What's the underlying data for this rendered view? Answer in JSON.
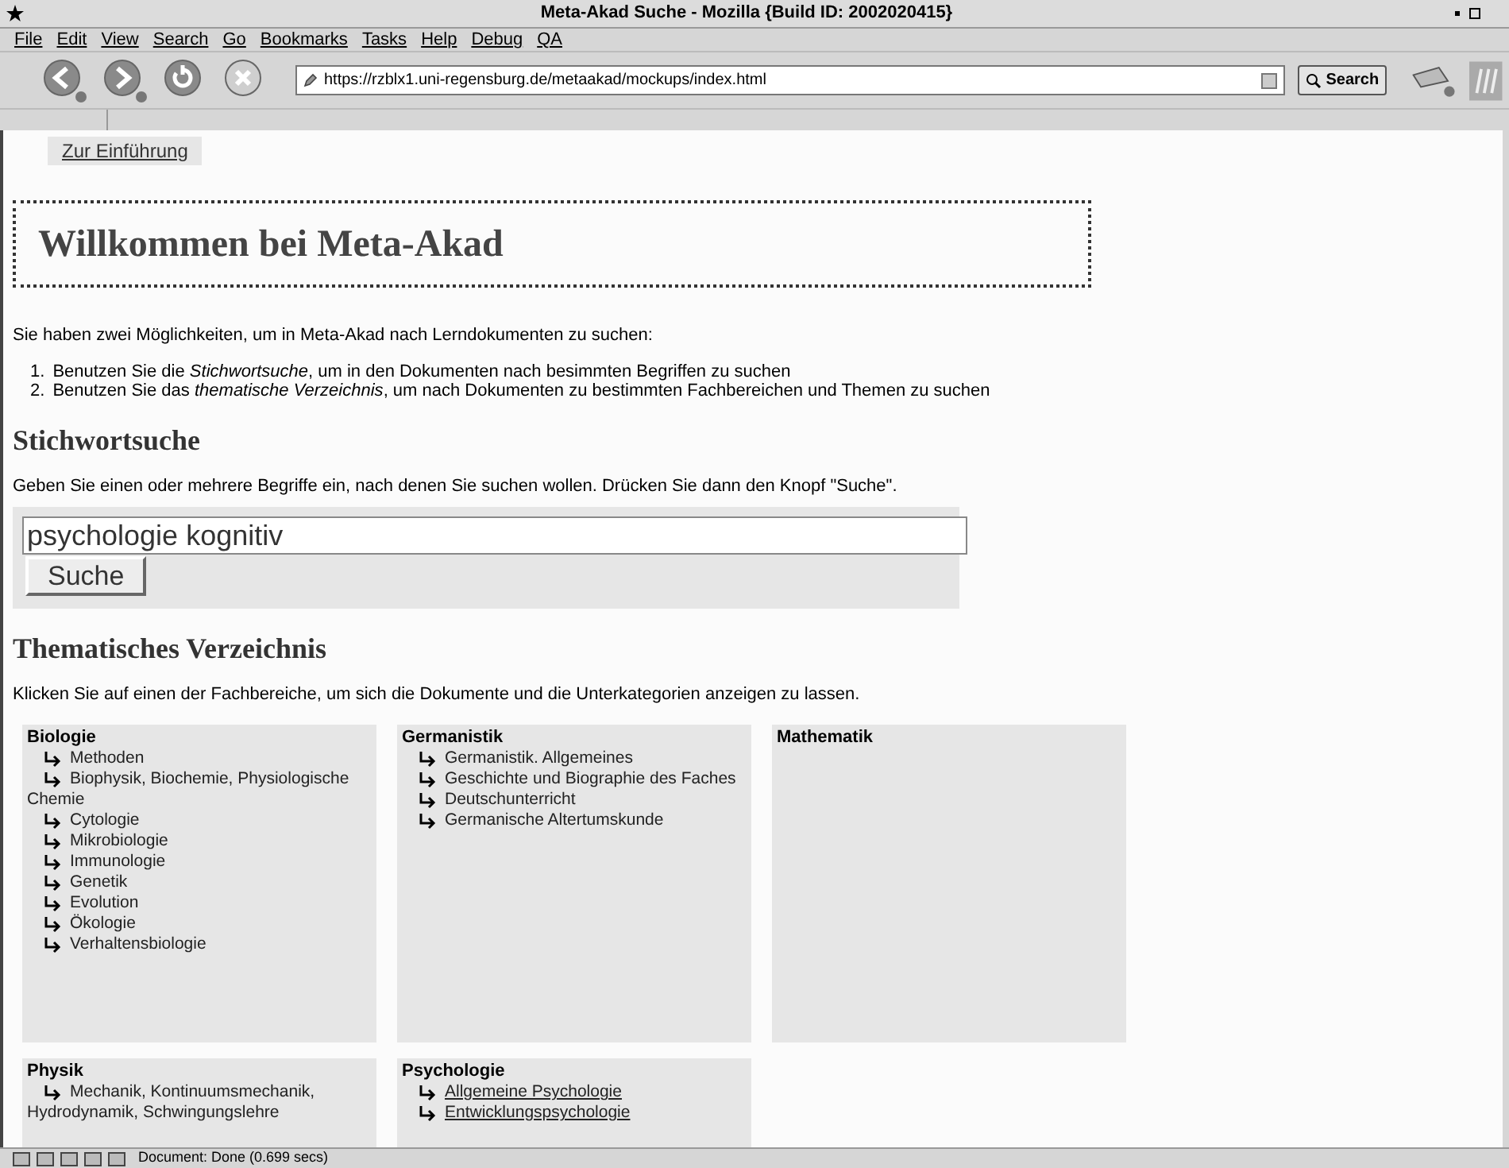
{
  "window": {
    "title": "Meta-Akad Suche - Mozilla {Build ID: 2002020415}"
  },
  "menu": [
    "File",
    "Edit",
    "View",
    "Search",
    "Go",
    "Bookmarks",
    "Tasks",
    "Help",
    "Debug",
    "QA"
  ],
  "toolbar": {
    "url": "https://rzblx1.uni-regensburg.de/metaakad/mockups/index.html",
    "search_button": "Search"
  },
  "nav_link": "Zur Einführung",
  "heading": "Willkommen bei Meta-Akad",
  "intro": "Sie haben zwei Möglichkeiten, um in Meta-Akad nach Lerndokumenten zu suchen:",
  "options": [
    {
      "number": "1.",
      "text": "Benutzen Sie die *Stichwortsuche*, um in den Dokumenten nach besimmten Begriffen zu suchen"
    },
    {
      "number": "2.",
      "text": "Benutzen Sie das *thematische  Verzeichnis*, um nach Dokumenten zu bestimmten Fachbereichen und Themen zu suchen"
    }
  ],
  "keyword_search": {
    "title": "Stichwortsuche",
    "hint": "Geben Sie einen oder mehrere Begriffe ein, nach denen Sie suchen wollen. Drücken Sie dann den Knopf \"Suche\".",
    "value": "psychologie kognitiv",
    "button": "Suche"
  },
  "directory": {
    "title": "Thematisches Verzeichnis",
    "hint": "Klicken Sie auf einen der Fachbereiche, um sich die Dokumente und die Unterkategorien anzeigen zu lassen.",
    "categories": [
      {
        "name": "Biologie",
        "children": [
          {
            "label": "Methoden",
            "underlined": false
          },
          {
            "label": "Biophysik, Biochemie, Physiologische Chemie",
            "underlined": false
          },
          {
            "label": "Cytologie",
            "underlined": false
          },
          {
            "label": "Mikrobiologie",
            "underlined": false
          },
          {
            "label": "Immunologie",
            "underlined": false
          },
          {
            "label": "Genetik",
            "underlined": false
          },
          {
            "label": "Evolution",
            "underlined": false
          },
          {
            "label": "Ökologie",
            "underlined": false
          },
          {
            "label": "Verhaltensbiologie",
            "underlined": false
          }
        ]
      },
      {
        "name": "Germanistik",
        "children": [
          {
            "label": "Germanistik. Allgemeines",
            "underlined": false
          },
          {
            "label": "Geschichte und Biographie des Faches",
            "underlined": false
          },
          {
            "label": "Deutschunterricht",
            "underlined": false
          },
          {
            "label": "Germanische Altertumskunde",
            "underlined": false
          }
        ]
      },
      {
        "name": "Mathematik"
      },
      {
        "name": "Physik",
        "children": [
          {
            "label": "Mechanik, Kontinuumsmechanik, Hydrodynamik, Schwingungslehre",
            "underlined": false
          }
        ]
      },
      {
        "name": "Psychologie",
        "children": [
          {
            "label": "Allgemeine Psychologie",
            "underlined": true
          },
          {
            "label": "Entwicklungspsychologie",
            "underlined": true
          }
        ]
      }
    ]
  },
  "status_bar": {
    "text": "Document: Done (0.699 secs)"
  }
}
